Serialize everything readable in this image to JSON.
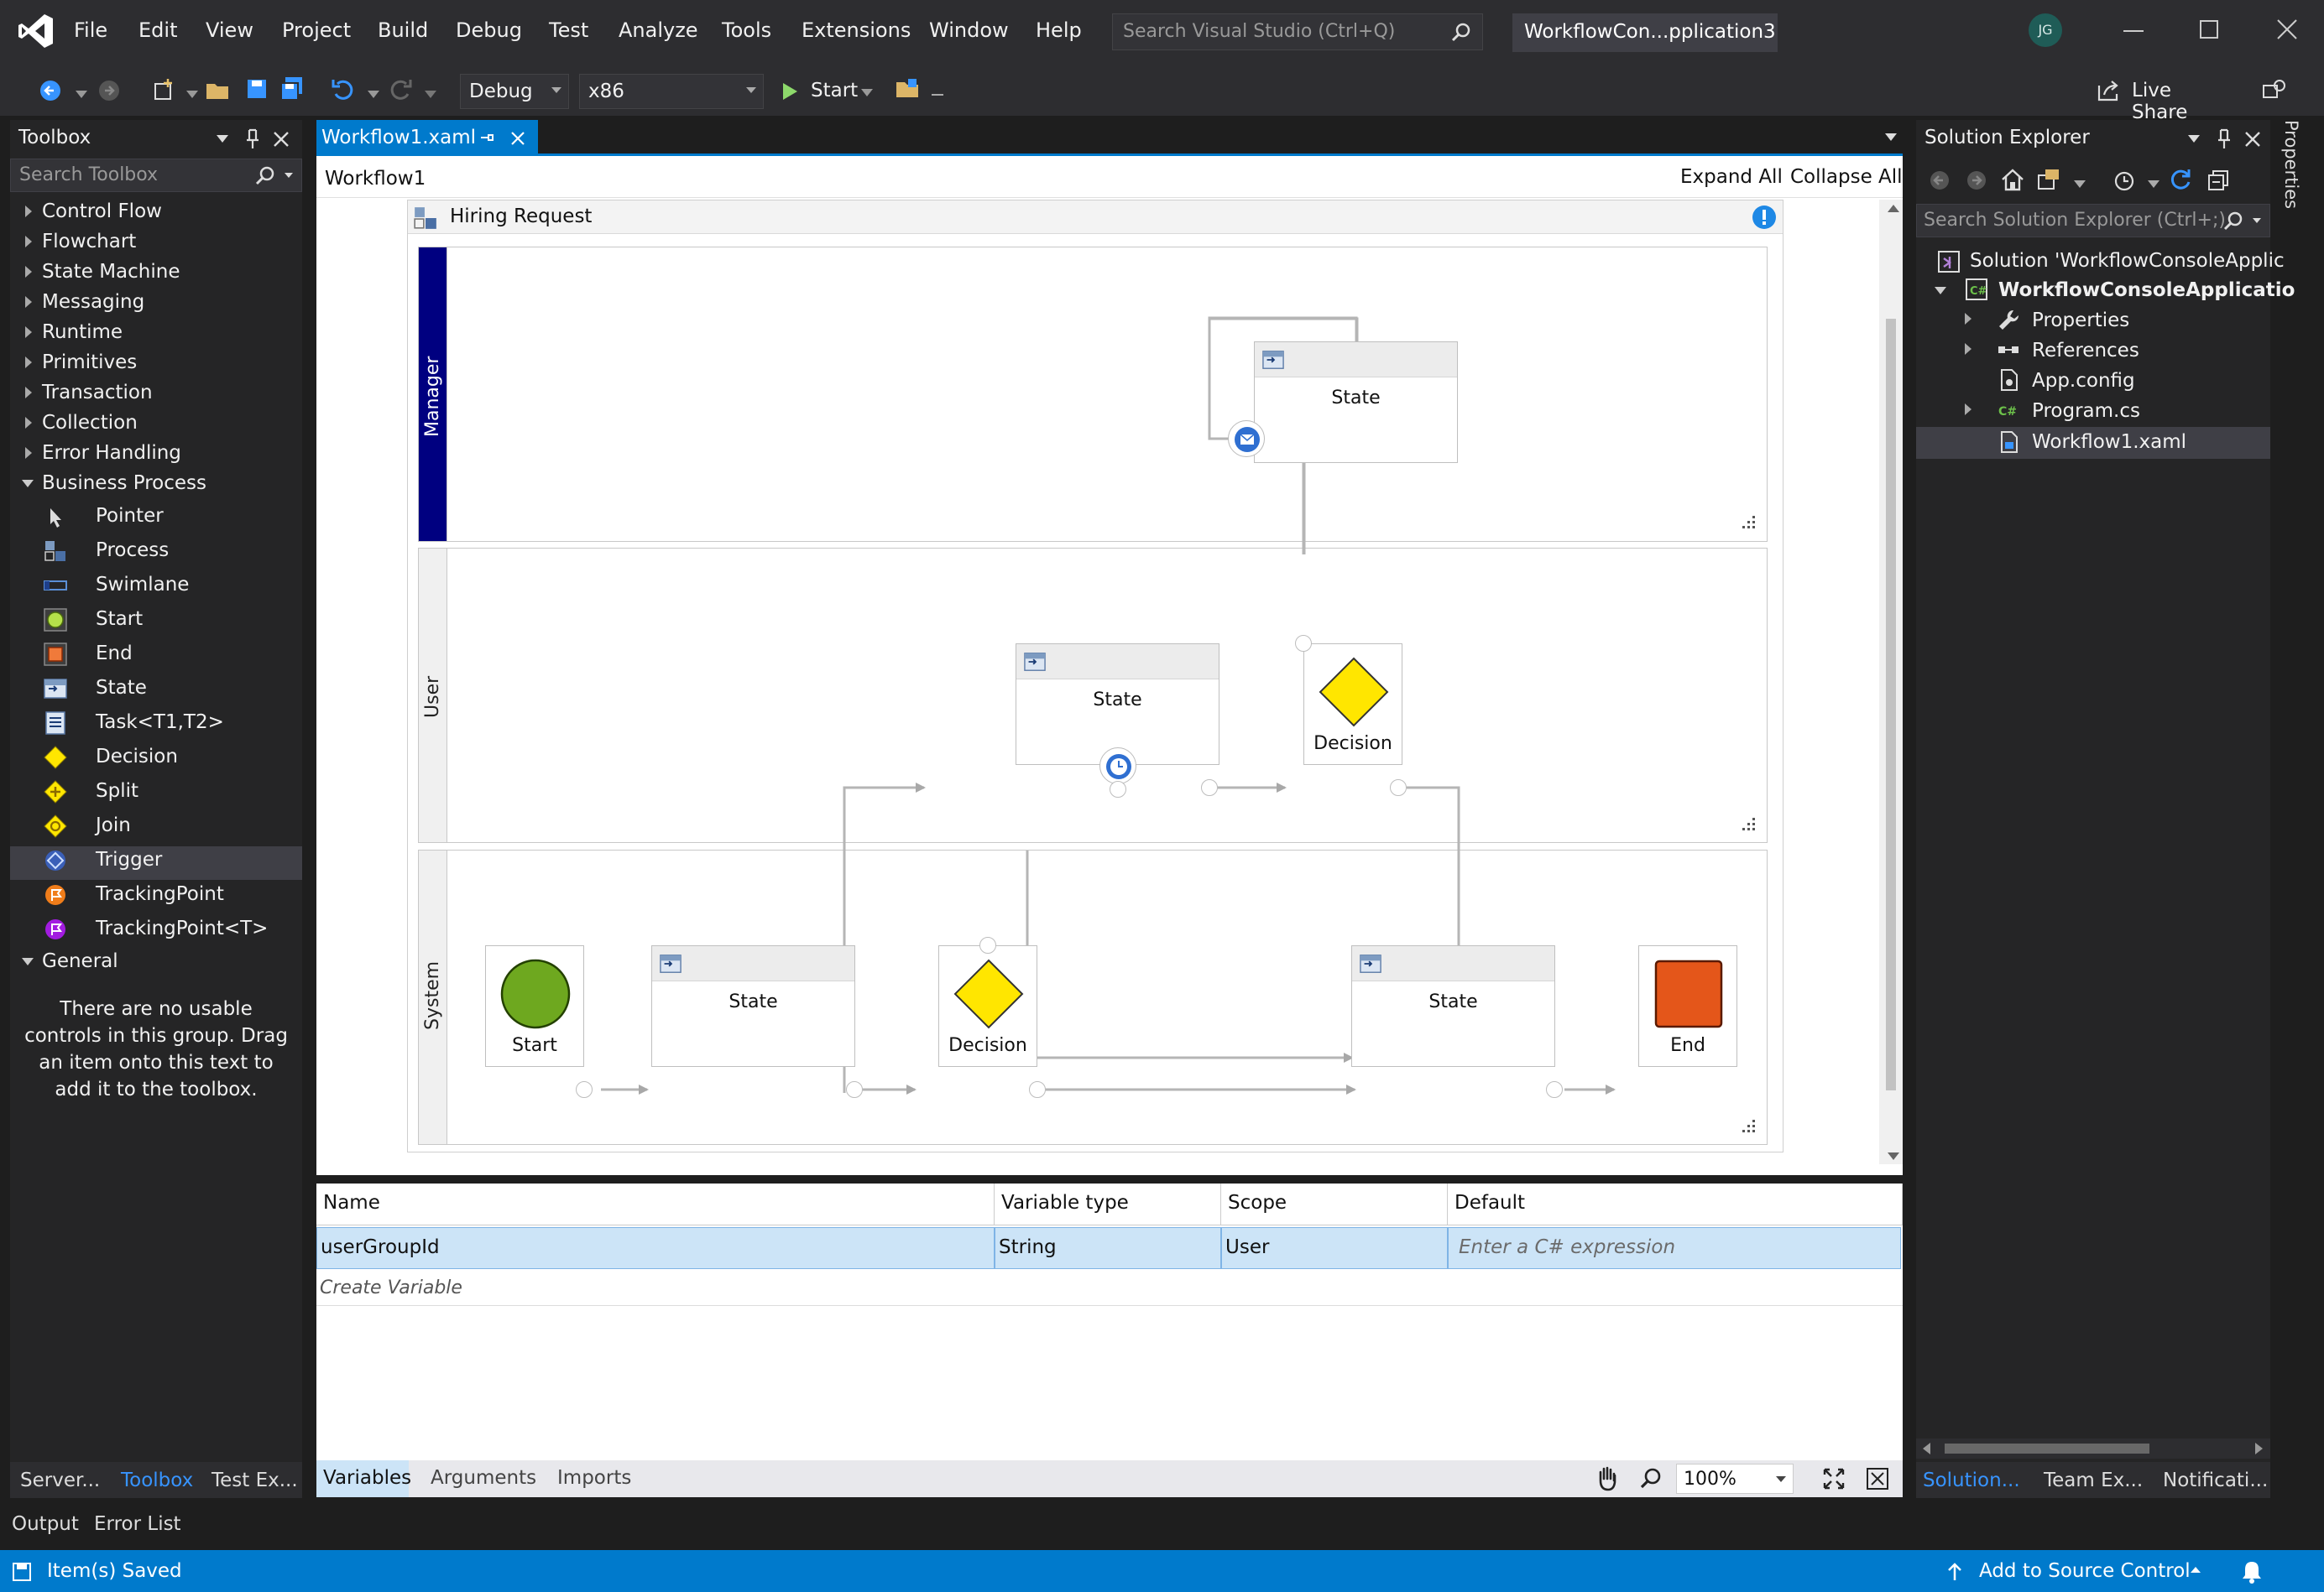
{
  "menu": [
    "File",
    "Edit",
    "View",
    "Project",
    "Build",
    "Debug",
    "Test",
    "Analyze",
    "Tools",
    "Extensions",
    "Window",
    "Help"
  ],
  "search_vs_placeholder": "Search Visual Studio (Ctrl+Q)",
  "project_title": "WorkflowCon...pplication3",
  "user_initials": "JG",
  "toolbar": {
    "config": "Debug",
    "platform": "x86",
    "start": "Start",
    "live_share": "Live Share"
  },
  "toolbox": {
    "title": "Toolbox",
    "search_placeholder": "Search Toolbox",
    "groups": [
      "Control Flow",
      "Flowchart",
      "State Machine",
      "Messaging",
      "Runtime",
      "Primitives",
      "Transaction",
      "Collection",
      "Error Handling"
    ],
    "business_process": "Business Process",
    "items": [
      "Pointer",
      "Process",
      "Swimlane",
      "Start",
      "End",
      "State",
      "Task<T1,T2>",
      "Decision",
      "Split",
      "Join",
      "Trigger",
      "TrackingPoint",
      "TrackingPoint<T>"
    ],
    "general": "General",
    "general_empty": "There are no usable controls in this group. Drag an item onto this text to add it to the toolbox.",
    "bottom_tabs": [
      "Server...",
      "Toolbox",
      "Test Ex..."
    ]
  },
  "doc_tab": "Workflow1.xaml",
  "designer": {
    "breadcrumb": "Workflow1",
    "expand_all": "Expand All",
    "collapse_all": "Collapse All",
    "process_title": "Hiring Request",
    "lanes": [
      "Manager",
      "User",
      "System"
    ],
    "state_label": "State",
    "decision_label": "Decision",
    "start_label": "Start",
    "end_label": "End"
  },
  "variables": {
    "headers": [
      "Name",
      "Variable type",
      "Scope",
      "Default"
    ],
    "row": {
      "name": "userGroupId",
      "type": "String",
      "scope": "User",
      "default_placeholder": "Enter a C# expression"
    },
    "create": "Create Variable",
    "tabs": [
      "Variables",
      "Arguments",
      "Imports"
    ],
    "zoom": "100%"
  },
  "solution": {
    "title": "Solution Explorer",
    "search_placeholder": "Search Solution Explorer (Ctrl+;)",
    "solution_item": "Solution 'WorkflowConsoleApplic",
    "project_item": "WorkflowConsoleApplicatio",
    "children": [
      "Properties",
      "References",
      "App.config",
      "Program.cs",
      "Workflow1.xaml"
    ],
    "bottom_tabs": [
      "Solution...",
      "Team Ex...",
      "Notificati..."
    ]
  },
  "properties_tab": "Properties",
  "output_tabs": [
    "Output",
    "Error List"
  ],
  "status": {
    "text": "Item(s) Saved",
    "source_control": "Add to Source Control"
  },
  "colors": {
    "accent": "#007acc",
    "manager_lane": "#000080",
    "start_green": "#6ea81f",
    "end_orange": "#e4561a",
    "decision_yellow": "#ffe600"
  }
}
